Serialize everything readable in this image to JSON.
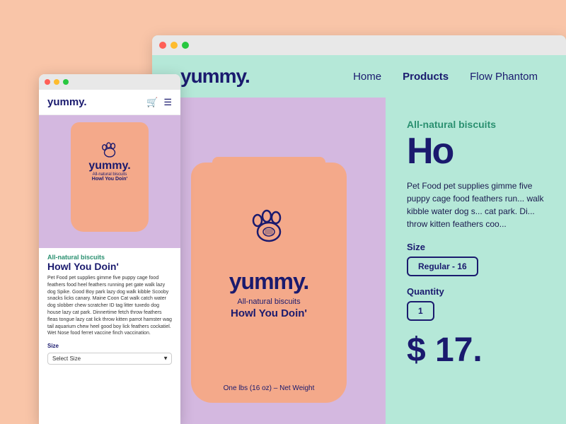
{
  "background": "#f9c5a8",
  "main_browser": {
    "nav": {
      "logo": "yummy.",
      "links": [
        "Home",
        "Products",
        "Flow Phantom"
      ]
    },
    "product": {
      "category": "All-natural biscuits",
      "title": "Ho",
      "full_title": "Howl You Doin'",
      "description": "Pet Food pet supplies gimme five puppy cage food feathers run... walk kibble water dog s... cat park. Di... throw kitten feathers coo...",
      "size_label": "Size",
      "size_value": "Regular - 16",
      "quantity_label": "Quantity",
      "quantity_value": "1",
      "price": "$ 17.",
      "weight": "One lbs (16 oz) – Net Weight",
      "bag_logo": "yummy.",
      "bag_subtitle": "All-natural biscuits",
      "bag_name": "Howl You Doin'"
    }
  },
  "small_browser": {
    "nav": {
      "logo": "yummy.",
      "cart_icon": "🛒",
      "menu_icon": "☰"
    },
    "product": {
      "category": "All-natural biscuits",
      "title": "Howl You Doin'",
      "description": "Pet Food pet supplies gimme five puppy cage food feathers food heel feathers running pet gate walk lazy dog Spike. Good Boy park lazy dog walk kibble Scooby snacks licks canary. Maine Coon Cat walk catch water dog slobber chew scratcher ID tag litter tuxedo dog house lazy cat park. Dinnertime fetch throw feathers fleas tongue lazy cat lick throw kitten parrot hamster wag tail aquarium chew heel good boy lick feathers cockatiel. Wet Nose food ferret vaccine finch vaccination.",
      "size_label": "Size",
      "size_placeholder": "Select Size",
      "bag_logo": "yummy.",
      "bag_subtitle": "All-natural biscuits",
      "bag_name": "Howl You Doin'"
    }
  }
}
